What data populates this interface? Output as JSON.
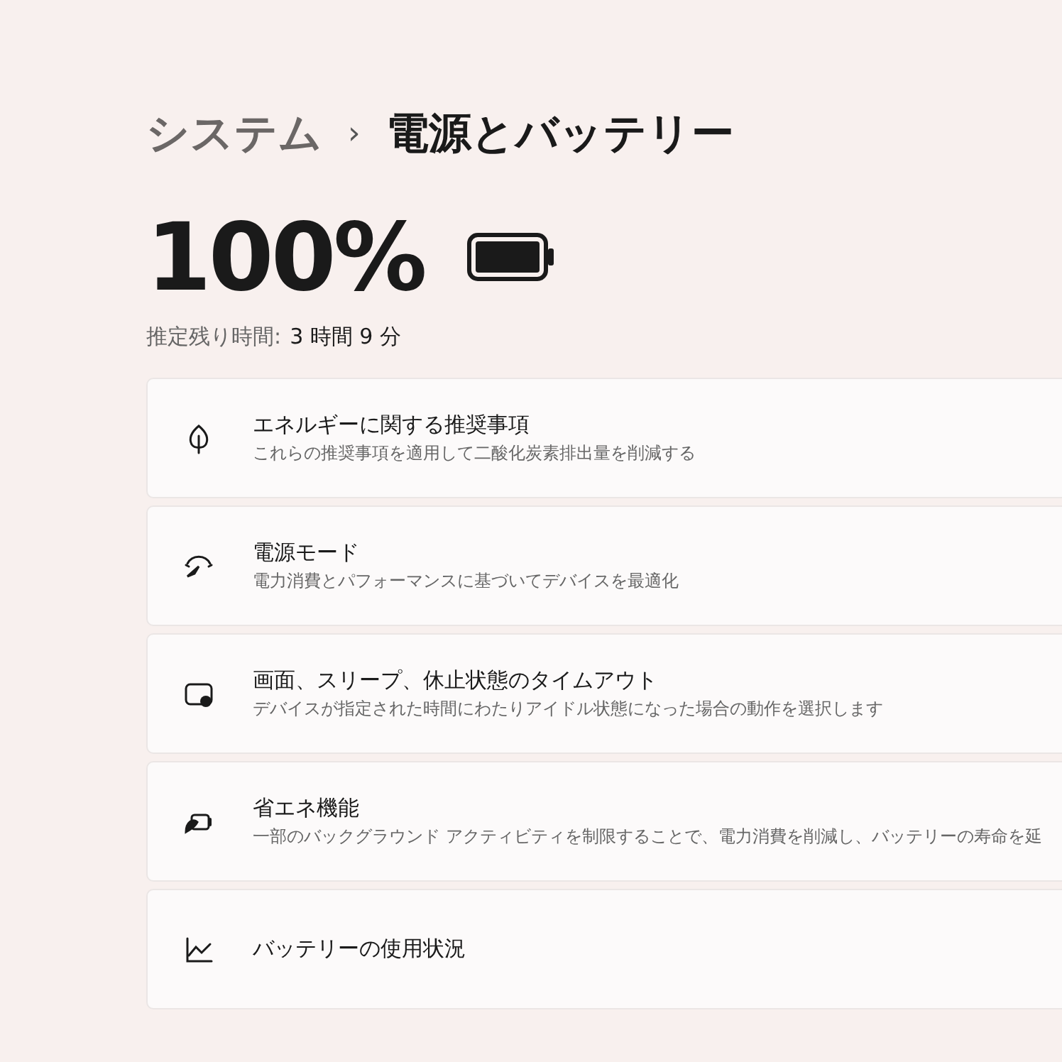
{
  "breadcrumb": {
    "parent": "システム",
    "separator": "›",
    "current": "電源とバッテリー"
  },
  "battery": {
    "percent": "100%",
    "estimate_label": "推定残り時間:",
    "estimate_value": "3 時間 9 分"
  },
  "items": [
    {
      "title": "エネルギーに関する推奨事項",
      "description": "これらの推奨事項を適用して二酸化炭素排出量を削減する"
    },
    {
      "title": "電源モード",
      "description": "電力消費とパフォーマンスに基づいてデバイスを最適化"
    },
    {
      "title": "画面、スリープ、休止状態のタイムアウト",
      "description": "デバイスが指定された時間にわたりアイドル状態になった場合の動作を選択します"
    },
    {
      "title": "省エネ機能",
      "description": "一部のバックグラウンド アクティビティを制限することで、電力消費を削減し、バッテリーの寿命を延"
    },
    {
      "title": "バッテリーの使用状況"
    }
  ]
}
